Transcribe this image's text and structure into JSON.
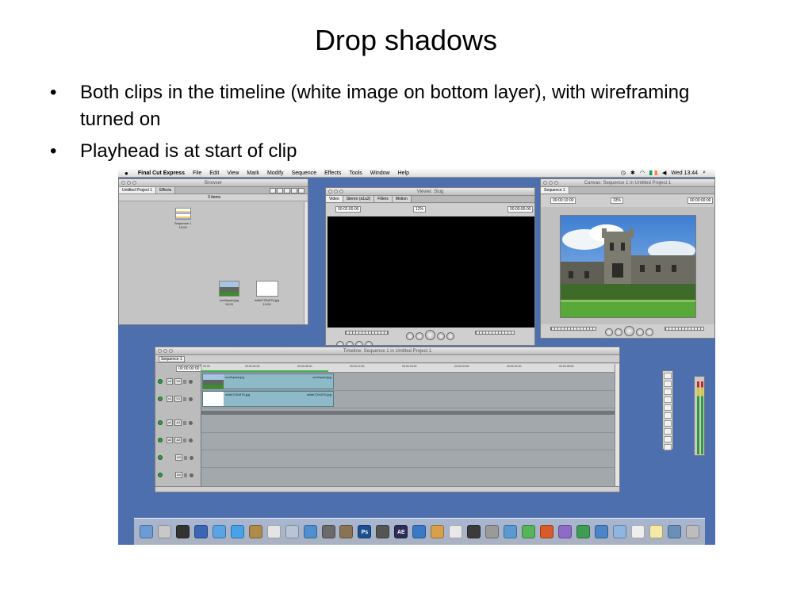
{
  "slide": {
    "title": "Drop shadows",
    "bullets": [
      "Both clips in the timeline (white image on bottom layer), with wireframing turned on",
      "Playhead is at start of clip"
    ],
    "bullet_symbol": "•"
  },
  "menubar": {
    "apple": "",
    "app_name": "Final Cut Express",
    "menus": [
      "File",
      "Edit",
      "View",
      "Mark",
      "Modify",
      "Sequence",
      "Effects",
      "Tools",
      "Window",
      "Help"
    ],
    "clock": "Wed 13:44"
  },
  "browser": {
    "title": "Browser",
    "tabs": [
      "Untitled Project 1",
      "Effects"
    ],
    "items_count": "3 items",
    "items": [
      {
        "name": "Sequence 1",
        "duration": "10:00"
      },
      {
        "name": "ucc5quad.jpg",
        "duration": "10:00"
      },
      {
        "name": "white720x576.jpg",
        "duration": "10:00"
      }
    ]
  },
  "viewer": {
    "title": "Viewer: Slug",
    "tabs": [
      "Video",
      "Stereo (a1a2)",
      "Filters",
      "Motion"
    ],
    "timecode_duration": "00:02:00:00",
    "zoom": "12%",
    "timecode_current": "00:00:00:00"
  },
  "canvas": {
    "title": "Canvas: Sequence 1 in Untitled Project 1",
    "tab": "Sequence 1",
    "timecode_duration": "00:00:10:00",
    "zoom": "33%",
    "timecode_current": "00:00:00:00"
  },
  "timeline": {
    "title": "Timeline: Sequence 1 in Untitled Project 1",
    "tab": "Sequence 1",
    "timecode": "00:00:00:00",
    "ruler": [
      "00:00",
      "00:00:04:00",
      "00:00:08:00",
      "00:00:12:00",
      "00:00:16:00",
      "00:00:20:00",
      "00:00:24:00",
      "00:00:28:00"
    ],
    "video_tracks": [
      {
        "label": "V2",
        "clip": "ucc5quad.jpg"
      },
      {
        "label": "V1",
        "clip": "white720x576.jpg"
      }
    ],
    "audio_tracks": [
      "A1",
      "A2",
      "A3",
      "A4"
    ],
    "source_labels": [
      "v2",
      "v1",
      "a1",
      "a2"
    ]
  },
  "dock": {
    "icons": [
      "finder",
      "mail",
      "dashboard",
      "xcode",
      "safari",
      "ichat",
      "address-book",
      "ical",
      "itunes",
      "iphoto",
      "imovie",
      "idvd",
      "ps",
      "final-cut",
      "ae",
      "quicktime",
      "garageband",
      "preview",
      "dvd-player",
      "system-prefs",
      "web",
      "music",
      "flash",
      "dreamweaver",
      "msn",
      "keynote",
      "folder",
      "documents",
      "stickies",
      "photos",
      "trash"
    ],
    "ps_label": "Ps",
    "ae_label": "AE"
  },
  "colors": {
    "desktop": "#4e6fae",
    "clip": "#8eb9c6"
  }
}
